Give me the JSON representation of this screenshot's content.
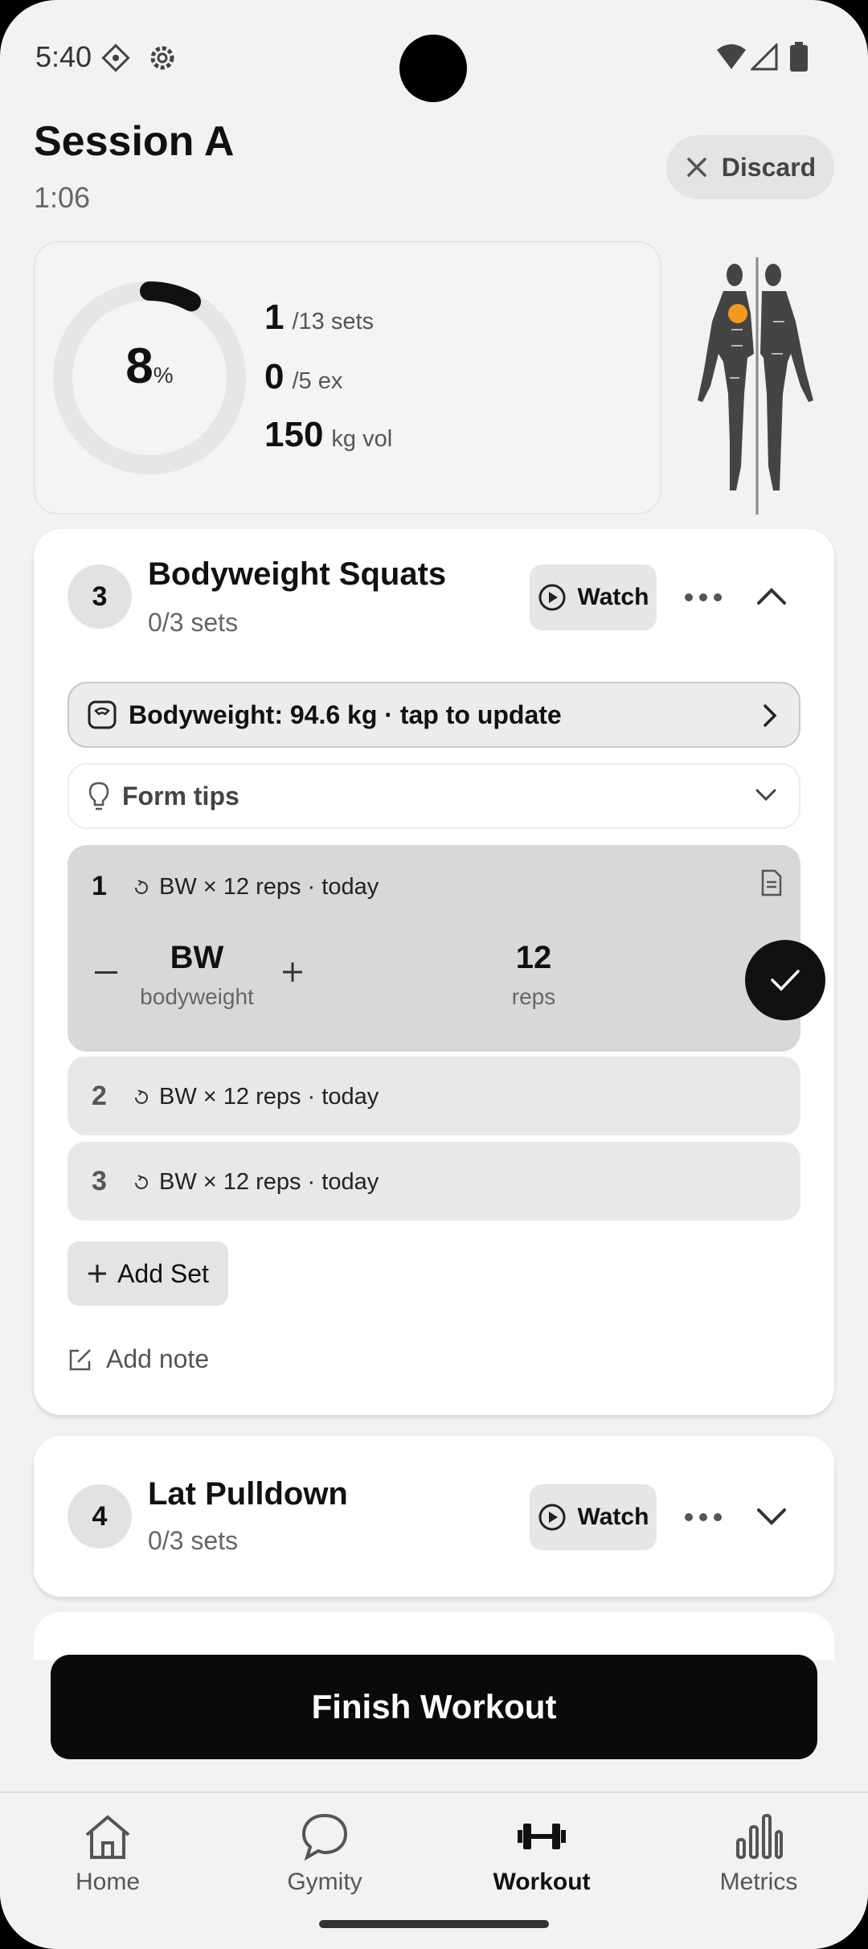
{
  "status_bar": {
    "time": "5:40"
  },
  "header": {
    "title": "Session A",
    "timer": "1:06",
    "discard_label": "Discard"
  },
  "summary": {
    "progress_percent": 8,
    "percent_unit": "%",
    "sets_done": "1",
    "sets_unit": "/13 sets",
    "ex_done": "0",
    "ex_unit": "/5 ex",
    "volume": "150",
    "volume_unit": "kg vol"
  },
  "exercise_active": {
    "number": "3",
    "name": "Bodyweight Squats",
    "progress": "0/3 sets",
    "watch_label": "Watch",
    "bodyweight_label": "Bodyweight: 94.6 kg · tap to update",
    "form_tips_label": "Form tips",
    "sets": [
      {
        "num": "1",
        "prev": "BW × 12 reps · today",
        "weight": "BW",
        "weight_label": "bodyweight",
        "reps": "12",
        "reps_label": "reps"
      },
      {
        "num": "2",
        "prev": "BW × 12 reps · today"
      },
      {
        "num": "3",
        "prev": "BW × 12 reps · today"
      }
    ],
    "add_set_label": "Add Set",
    "add_note_label": "Add note"
  },
  "exercise_next": {
    "number": "4",
    "name": "Lat Pulldown",
    "progress": "0/3 sets",
    "watch_label": "Watch"
  },
  "finish_label": "Finish Workout",
  "nav": [
    {
      "label": "Home",
      "icon": "home-icon",
      "active": false
    },
    {
      "label": "Gymity",
      "icon": "chat-bubble-icon",
      "active": false
    },
    {
      "label": "Workout",
      "icon": "dumbbell-icon",
      "active": true
    },
    {
      "label": "Metrics",
      "icon": "bar-chart-icon",
      "active": false
    }
  ],
  "colors": {
    "accent": "#0a0a0a",
    "muscle_highlight": "#f39a1e",
    "card": "#ffffff",
    "background": "#f2f2f2"
  }
}
